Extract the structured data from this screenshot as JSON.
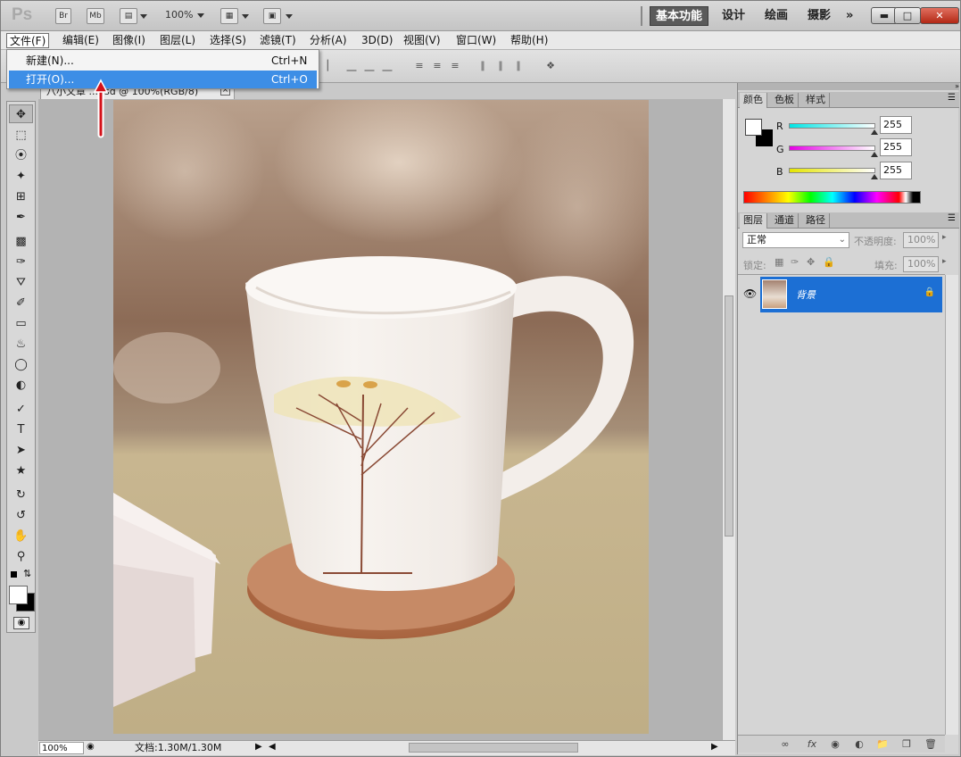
{
  "titlebar": {
    "logo": "Ps",
    "br": "Br",
    "mb": "Mb",
    "zoom": "100%",
    "workspaces": [
      "基本功能",
      "设计",
      "绘画",
      "摄影"
    ],
    "more": "»"
  },
  "menubar": {
    "items": [
      "文件(F)",
      "编辑(E)",
      "图像(I)",
      "图层(L)",
      "选择(S)",
      "滤镜(T)",
      "分析(A)",
      "3D(D)",
      "视图(V)",
      "窗口(W)",
      "帮助(H)"
    ]
  },
  "file_menu": {
    "items": [
      {
        "label": "新建(N)...",
        "shortcut": "Ctrl+N"
      },
      {
        "label": "打开(O)...",
        "shortcut": "Ctrl+O"
      }
    ]
  },
  "document": {
    "tab_title": "八小文章 ...psd @ 100%(RGB/8)",
    "zoom": "100%",
    "doc_info": "文档:1.30M/1.30M"
  },
  "color_panel": {
    "tabs": [
      "颜色",
      "色板",
      "样式"
    ],
    "channels": [
      {
        "name": "R",
        "value": "255",
        "color": "#00e5e5"
      },
      {
        "name": "G",
        "value": "255",
        "color": "#e500e5"
      },
      {
        "name": "B",
        "value": "255",
        "color": "#e5e500"
      }
    ]
  },
  "layers_panel": {
    "tabs": [
      "图层",
      "通道",
      "路径"
    ],
    "blend_mode": "正常",
    "opacity_label": "不透明度:",
    "opacity": "100%",
    "lock_label": "锁定:",
    "fill_label": "填充:",
    "fill": "100%",
    "layers": [
      {
        "name": "背景",
        "selected": true
      }
    ]
  }
}
